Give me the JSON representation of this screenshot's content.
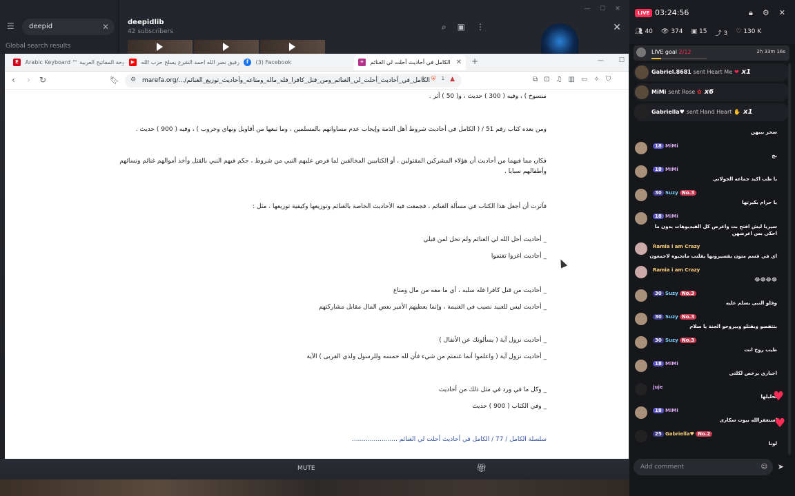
{
  "telegram": {
    "search_value": "deepid",
    "global_results_label": "Global search results",
    "chat_title": "deepidlib",
    "chat_subtitle": "42 subscribers"
  },
  "browser": {
    "tabs": [
      {
        "label": "Arabic Keyboard ™ لوحة المفاتيح العربية",
        "favicon": "E",
        "color": "#d0021b"
      },
      {
        "label": "رفيق نصر الله احمد الشرع يسلح حزب الله",
        "favicon": "▶",
        "color": "#ff0000"
      },
      {
        "label": "(3) Facebook",
        "favicon": "f",
        "color": "#1877f2"
      },
      {
        "label": "الكامل في أحاديث أحلت لي الغنائم",
        "favicon": "✦",
        "color": "#b5338a"
      }
    ],
    "new_tab": "+",
    "url": "marefa.org/.../الكامل_في_أحاديث_أحلت_لي_الغنائم_ومن_قتل_كافرا_فله_ماله_ومتاعه_وأحاديث_توزيع_الغنائم",
    "shield_count": "1"
  },
  "article": {
    "lines": [
      "منسوخ ) ، وفيه ( 300 ) حديث ، و( 50 ) أثر .",
      "ومن بعده كتاب رقم 51 / ( الكامل في أحاديث شروط أهل الذمة وإيجاب عدم مساواتهم بالمسلمين ، وما تبعها من أقاويل ونهاي وحروب ) ، وفيه ( 900 ) حديث .",
      "فكان مما فيهما من أحاديث أن هؤلاء المشركين المقتولين ، أو الكتابيين المخالفين لما فرض عليهم النبي من شروط ، حكم فيهم النبي بالقتل وأخذ أموالهم غنائم ونسائهم وأطفالهم سبايا .",
      "فآثرت أن أجعل هذا الكتاب في مسألة الغنائم ، فجمعت فيه الأحاديث الخاصة بالغنائم وتوزيعها وكيفية توزيعها . مثل :",
      "_ أحاديث أحل الله لي الغنائم ولم تحل لمن قبلي",
      "_ أحاديث اغزوا تغنموا",
      "_ أحاديث من قتل كافرا فله سلبه ، أي ما معه من مال ومتاع",
      "_ أحاديث ليس للعبيد نصيب في الغنيمة ، وإنما يعطيهم الأمير بعض المال مقابل مشاركتهم",
      "_ أحاديث نزول آية ( يسألونك عن الأنفال )",
      "_ أحاديث نزول آية ( واعلموا أنما غنمتم من شيء فأن لله خمسه وللرسول ولذي القربى ) الآية",
      "_ وكل ما في ورد في مثل ذلك من أحاديث",
      "_ وفي الكتاب ( 900 ) حديث",
      "سلسلة الكامل / 77 / الكامل في أحاديث أحلت لي الغنائم ......................."
    ]
  },
  "live": {
    "badge": "LIVE",
    "timer": "03:24:56",
    "stats": [
      {
        "icon": "people-icon",
        "value": "40"
      },
      {
        "icon": "eye-icon",
        "value": "374"
      },
      {
        "icon": "box-icon",
        "value": "15"
      },
      {
        "icon": "share-icon",
        "value": "3"
      },
      {
        "icon": "heart-icon",
        "value": "130 K"
      }
    ],
    "goal": {
      "label": "LIVE goal",
      "progress": "2/12",
      "progress_fraction": 0.17,
      "time": "2h 33m 16s"
    },
    "gifts": [
      {
        "user": "Gabriel.8681",
        "action": "sent Heart Me",
        "mult": "x1"
      },
      {
        "user": "MiMi",
        "action": "sent Rose",
        "mult": "x6"
      },
      {
        "user": "Gabriella♥",
        "action": "sent Hand Heart",
        "mult": "x1"
      }
    ],
    "comments": [
      {
        "level": "",
        "user": "",
        "badge": "",
        "text": "سحر بيبهن"
      },
      {
        "level": "18",
        "user": "MiMi",
        "badge": "",
        "text": "بخ"
      },
      {
        "level": "18",
        "user": "MiMi",
        "badge": "",
        "text": "يا ظب اكيد جماعة الجولاني"
      },
      {
        "level": "30",
        "user": "Suzy",
        "badge": "No.3",
        "text": "يا حرام بكيرتها"
      },
      {
        "level": "18",
        "user": "MiMi",
        "badge": "",
        "text": "سيريا ليش افتح بث واعرض كل الفيديوهات بدون ما احكي بس اعرضهن"
      },
      {
        "level": "",
        "user": "Ramia i am Crazy",
        "badge": "",
        "text": "اي في قسم متون يفسيرونها يفلتب مانجيوه لاحمعون"
      },
      {
        "level": "",
        "user": "Ramia i am Crazy",
        "badge": "",
        "text": "😂😂😂😂"
      },
      {
        "level": "30",
        "user": "Suzy",
        "badge": "No.3",
        "text": "وقلو النبي بسلم عليه"
      },
      {
        "level": "30",
        "user": "Suzy",
        "badge": "No.3",
        "text": "بتتفصو وبقتلو وبيروحو الجنة يا سلام"
      },
      {
        "level": "30",
        "user": "Suzy",
        "badge": "No.3",
        "text": "طيب روح انت"
      },
      {
        "level": "18",
        "user": "MiMi",
        "badge": "",
        "text": "اجباري يرخص لكلثي"
      },
      {
        "level": "",
        "user": "juje",
        "badge": "",
        "text": "تحليلها"
      },
      {
        "level": "18",
        "user": "MiMi",
        "badge": "",
        "text": "استغفرالله بيوت سكارى"
      },
      {
        "level": "25",
        "user": "Gabriella♥",
        "badge": "No.2",
        "text": "لونا"
      }
    ],
    "comment_placeholder": "Add comment"
  },
  "bottom": {
    "mute_label": "MUTE"
  }
}
